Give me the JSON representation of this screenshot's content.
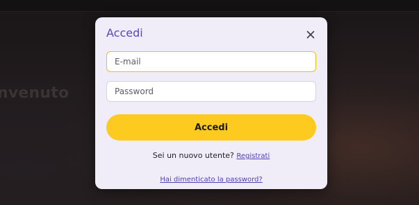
{
  "background": {
    "welcome_text": "nvenuto"
  },
  "modal": {
    "title": "Accedi",
    "close_icon": "close-icon",
    "email": {
      "placeholder": "E-mail",
      "value": ""
    },
    "password": {
      "placeholder": "Password",
      "value": ""
    },
    "submit_label": "Accedi",
    "register_prompt": "Sei un nuovo utente?",
    "register_link": "Registrati",
    "forgot_link": "Hai dimenticato la password?"
  },
  "colors": {
    "accent": "#5b45c0",
    "button": "#fdca1f",
    "focus_border": "#f2bd1c",
    "modal_bg": "#f0ecf8"
  }
}
